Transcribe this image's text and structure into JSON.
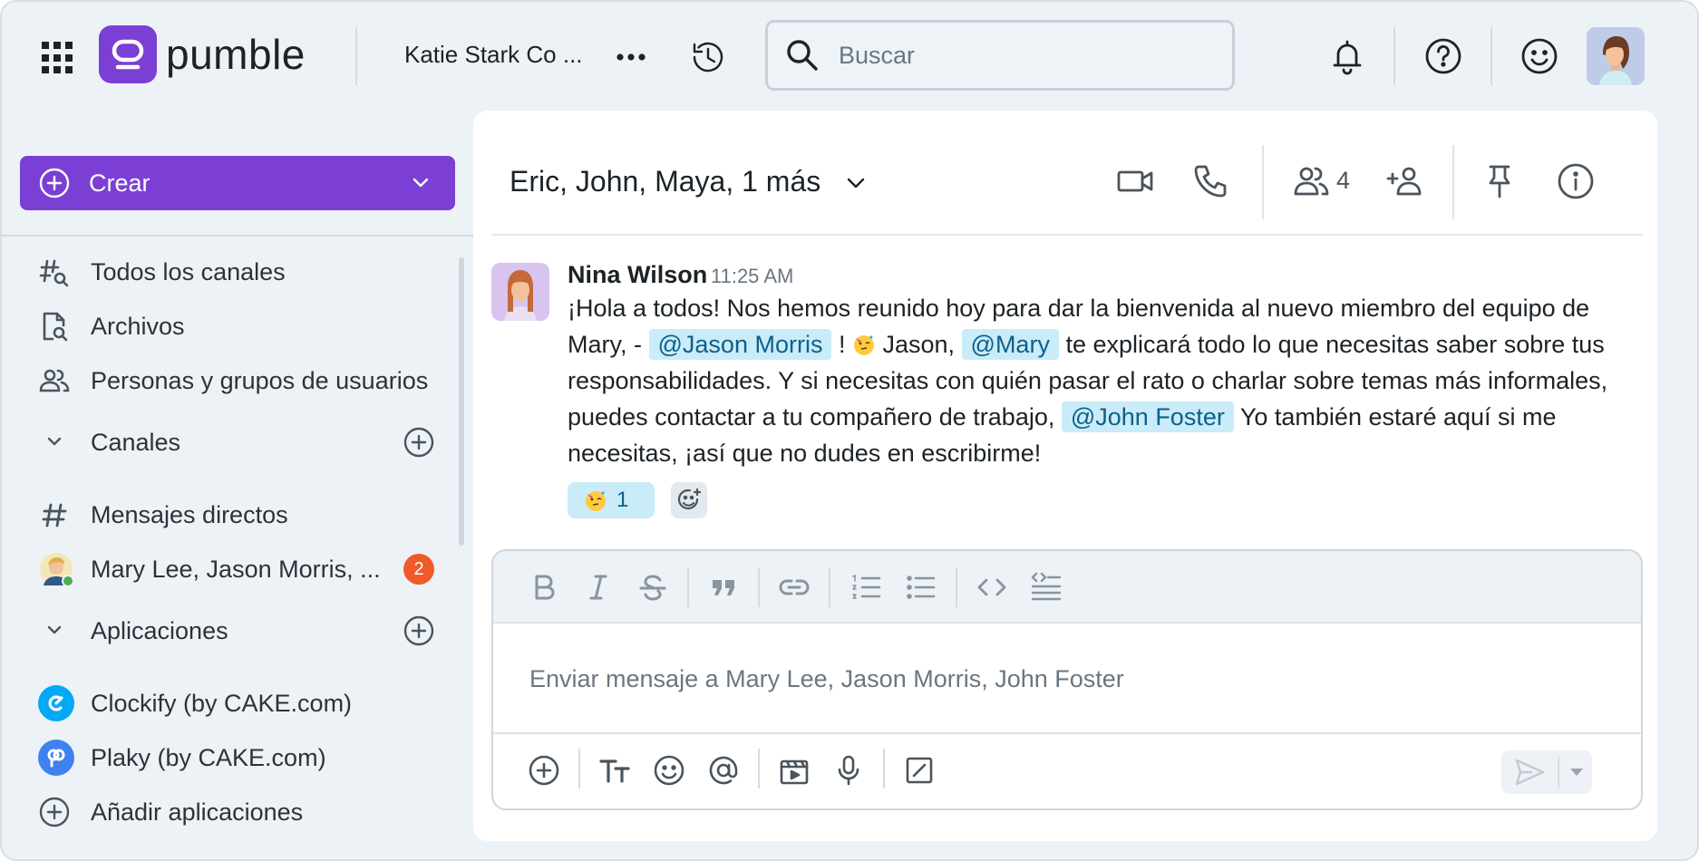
{
  "app": {
    "name": "pumble",
    "brand_color": "#7b3fd6",
    "mention_color": "#c9ecf8",
    "badge_color": "#f15a29"
  },
  "topbar": {
    "workspace_name": "Katie Stark Co ...",
    "search_placeholder": "Buscar"
  },
  "sidebar": {
    "create_label": "Crear",
    "items": [
      {
        "label": "Todos los canales",
        "icon": "hash-search-icon"
      },
      {
        "label": "Archivos",
        "icon": "file-search-icon"
      },
      {
        "label": "Personas y grupos de usuarios",
        "icon": "people-icon"
      }
    ],
    "channels_label": "Canales",
    "direct_messages_label": "Mensajes directos",
    "dm": {
      "label": "Mary Lee, Jason Morris, ...",
      "unread": "2"
    },
    "apps_label": "Aplicaciones",
    "apps": [
      {
        "label": "Clockify (by CAKE.com)",
        "color": "#03a9f4"
      },
      {
        "label": "Plaky (by CAKE.com)",
        "color": "#3d82f0"
      }
    ],
    "add_apps_label": "Añadir aplicaciones"
  },
  "chat": {
    "title": "Eric, John, Maya, 1 más",
    "member_count": "4",
    "message": {
      "author": "Nina Wilson",
      "time": "11:25 AM",
      "text_1": "¡Hola a todos! Nos hemos reunido hoy para dar la bienvenida al nuevo miembro del equipo de Mary, - ",
      "mention_1": "@Jason Morris",
      "text_2": " ! ",
      "text_3": " Jason, ",
      "mention_2": "@Mary",
      "text_4": " te explicará todo lo que necesitas saber sobre tus responsabilidades. Y si necesitas con quién pasar el rato o charlar sobre temas más informales, puedes contactar a tu compañero de trabajo, ",
      "mention_3": "@John Foster",
      "text_5": " Yo también estaré aquí si me necesitas, ¡así que no dudes en escribirme!",
      "reaction_count": "1"
    },
    "composer_placeholder": "Enviar mensaje a Mary Lee, Jason Morris, John Foster"
  }
}
